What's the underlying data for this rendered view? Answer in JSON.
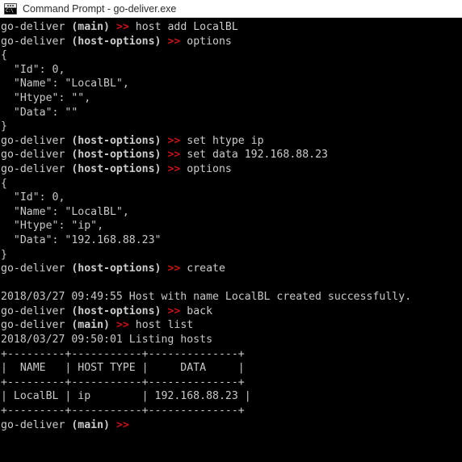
{
  "window": {
    "title": "Command Prompt - go-deliver.exe",
    "icon": "cmd-prompt-icon",
    "icon_glyph": "C:\\",
    "titlebar_bg": "#ffffff",
    "titlebar_fg": "#2b2b2b",
    "terminal_bg": "#000000",
    "terminal_fg": "#c8c8c8",
    "prompt_arrow_color": "#cc1111"
  },
  "prompts": {
    "app": "go-deliver",
    "context_main": "(main)",
    "context_host_options": "(host-options)",
    "arrow": ">>"
  },
  "lines": [
    {
      "type": "prompt",
      "context": "(main)",
      "command": "host add LocalBL"
    },
    {
      "type": "prompt",
      "context": "(host-options)",
      "command": "options"
    },
    {
      "type": "output",
      "text": "{"
    },
    {
      "type": "output",
      "text": "  \"Id\": 0,"
    },
    {
      "type": "output",
      "text": "  \"Name\": \"LocalBL\","
    },
    {
      "type": "output",
      "text": "  \"Htype\": \"\","
    },
    {
      "type": "output",
      "text": "  \"Data\": \"\""
    },
    {
      "type": "output",
      "text": "}"
    },
    {
      "type": "prompt",
      "context": "(host-options)",
      "command": "set htype ip"
    },
    {
      "type": "prompt",
      "context": "(host-options)",
      "command": "set data 192.168.88.23"
    },
    {
      "type": "prompt",
      "context": "(host-options)",
      "command": "options"
    },
    {
      "type": "output",
      "text": "{"
    },
    {
      "type": "output",
      "text": "  \"Id\": 0,"
    },
    {
      "type": "output",
      "text": "  \"Name\": \"LocalBL\","
    },
    {
      "type": "output",
      "text": "  \"Htype\": \"ip\","
    },
    {
      "type": "output",
      "text": "  \"Data\": \"192.168.88.23\""
    },
    {
      "type": "output",
      "text": "}"
    },
    {
      "type": "prompt",
      "context": "(host-options)",
      "command": "create"
    },
    {
      "type": "output",
      "text": ""
    },
    {
      "type": "output",
      "text": "2018/03/27 09:49:55 Host with name LocalBL created successfully."
    },
    {
      "type": "prompt",
      "context": "(host-options)",
      "command": "back"
    },
    {
      "type": "prompt",
      "context": "(main)",
      "command": "host list"
    },
    {
      "type": "output",
      "text": "2018/03/27 09:50:01 Listing hosts"
    },
    {
      "type": "output",
      "text": "+---------+-----------+--------------+"
    },
    {
      "type": "output",
      "text": "|  NAME   | HOST TYPE |     DATA     |"
    },
    {
      "type": "output",
      "text": "+---------+-----------+--------------+"
    },
    {
      "type": "output",
      "text": "| LocalBL | ip        | 192.168.88.23 |"
    },
    {
      "type": "output",
      "text": "+---------+-----------+--------------+"
    },
    {
      "type": "prompt",
      "context": "(main)",
      "command": ""
    }
  ],
  "host_table": {
    "headers": [
      "NAME",
      "HOST TYPE",
      "DATA"
    ],
    "rows": [
      [
        "LocalBL",
        "ip",
        "192.168.88.23"
      ]
    ]
  },
  "host_options": {
    "initial": {
      "Id": 0,
      "Name": "LocalBL",
      "Htype": "",
      "Data": ""
    },
    "final": {
      "Id": 0,
      "Name": "LocalBL",
      "Htype": "ip",
      "Data": "192.168.88.23"
    }
  },
  "log_messages": [
    {
      "timestamp": "2018/03/27 09:49:55",
      "text": "Host with name LocalBL created successfully."
    },
    {
      "timestamp": "2018/03/27 09:50:01",
      "text": "Listing hosts"
    }
  ]
}
